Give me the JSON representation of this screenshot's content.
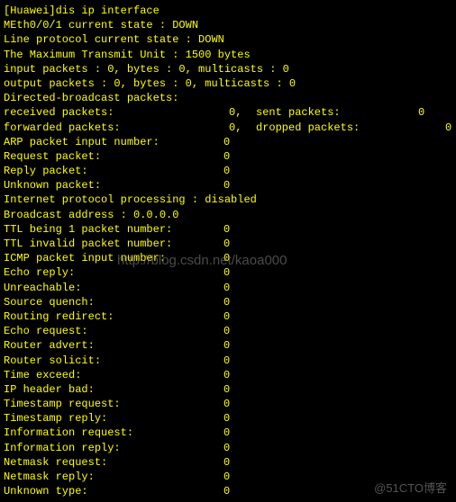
{
  "prompt": "[Huawei]dis ip interface",
  "iface": "MEth0/0/1 current state : DOWN",
  "lineproto": "Line protocol current state : DOWN",
  "mtu": "The Maximum Transmit Unit : 1500 bytes",
  "inpkts": "input packets : 0, bytes : 0, multicasts : 0",
  "outpkts": "output packets : 0, bytes : 0, multicasts : 0",
  "dirbcast": "Directed-broadcast packets:",
  "recv": {
    "label": " received packets:",
    "v1": "0,",
    "lbl2": "sent packets:",
    "v2": "0"
  },
  "fwd": {
    "label": " forwarded packets:",
    "v1": "0,",
    "lbl2": "dropped packets:",
    "v2": "0"
  },
  "arp_hdr": {
    "label": "ARP packet input number:",
    "v": "0"
  },
  "arp": [
    {
      "label": "  Request packet:",
      "v": "0"
    },
    {
      "label": "  Reply packet:",
      "v": "0"
    },
    {
      "label": "  Unknown packet:",
      "v": "0"
    }
  ],
  "ipproc": "Internet protocol processing : disabled",
  "bcast": "Broadcast address : 0.0.0.0",
  "ttl1": {
    "label": "TTL being 1 packet number:",
    "v": "0"
  },
  "ttlinv": {
    "label": "TTL invalid packet number:",
    "v": "0"
  },
  "icmp_hdr": {
    "label": "ICMP packet input number:",
    "v": "0"
  },
  "icmp": [
    {
      "label": "  Echo reply:",
      "v": "0"
    },
    {
      "label": "  Unreachable:",
      "v": "0"
    },
    {
      "label": "  Source quench:",
      "v": "0"
    },
    {
      "label": "  Routing redirect:",
      "v": "0"
    },
    {
      "label": "  Echo request:",
      "v": "0"
    },
    {
      "label": "  Router advert:",
      "v": "0"
    },
    {
      "label": "  Router solicit:",
      "v": "0"
    },
    {
      "label": "  Time exceed:",
      "v": "0"
    },
    {
      "label": "  IP header bad:",
      "v": "0"
    },
    {
      "label": "  Timestamp request:",
      "v": "0"
    },
    {
      "label": "  Timestamp reply:",
      "v": "0"
    },
    {
      "label": "  Information request:",
      "v": "0"
    },
    {
      "label": "  Information reply:",
      "v": "0"
    },
    {
      "label": "  Netmask request:",
      "v": "0"
    },
    {
      "label": "  Netmask reply:",
      "v": "0"
    },
    {
      "label": "  Unknown type:",
      "v": "0"
    }
  ],
  "wm1": "http://blog.csdn.net/kaoa000",
  "wm2": "@51CTO博客"
}
